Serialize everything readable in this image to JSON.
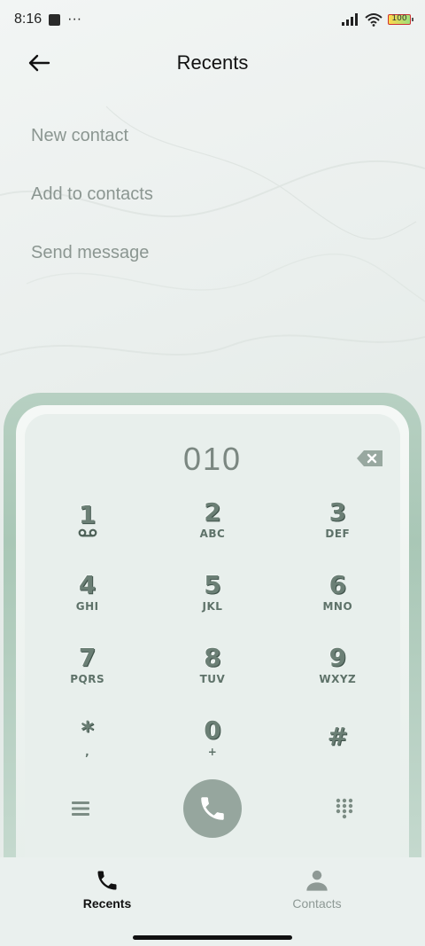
{
  "status_bar": {
    "time": "8:16",
    "dots": "···",
    "battery": "100"
  },
  "header": {
    "title": "Recents"
  },
  "menu": [
    {
      "label": "New contact"
    },
    {
      "label": "Add to contacts"
    },
    {
      "label": "Send message"
    }
  ],
  "dialpad": {
    "number": "010",
    "keys": [
      {
        "digit": "1",
        "letters": ""
      },
      {
        "digit": "2",
        "letters": "ABC"
      },
      {
        "digit": "3",
        "letters": "DEF"
      },
      {
        "digit": "4",
        "letters": "GHI"
      },
      {
        "digit": "5",
        "letters": "JKL"
      },
      {
        "digit": "6",
        "letters": "MNO"
      },
      {
        "digit": "7",
        "letters": "PQRS"
      },
      {
        "digit": "8",
        "letters": "TUV"
      },
      {
        "digit": "9",
        "letters": "WXYZ"
      },
      {
        "digit": "*",
        "letters": ","
      },
      {
        "digit": "0",
        "letters": "+"
      },
      {
        "digit": "#",
        "letters": ""
      }
    ]
  },
  "nav": {
    "recents_label": "Recents",
    "contacts_label": "Contacts"
  },
  "colors": {
    "accent": "#96a69e",
    "frame": "#a9c7b6",
    "menu_text": "#8b9691",
    "inactive_nav": "#8e9995"
  },
  "icons": [
    "back-arrow-icon",
    "voicemail-icon",
    "backspace-icon",
    "menu-icon",
    "phone-icon",
    "dialpad-icon",
    "person-icon",
    "wifi-icon",
    "signal-icon",
    "battery-icon"
  ]
}
